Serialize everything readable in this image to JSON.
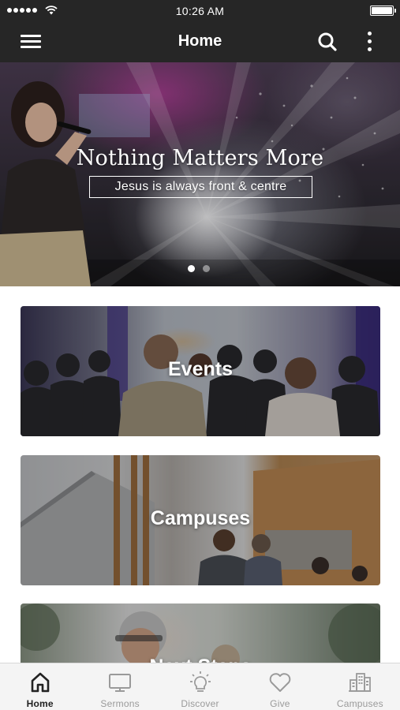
{
  "status_bar": {
    "time": "10:26 AM"
  },
  "nav": {
    "title": "Home"
  },
  "hero": {
    "headline": "Nothing Matters More",
    "tagline": "Jesus is always front & centre",
    "slide_count": 2,
    "active_slide": 1
  },
  "cards": [
    {
      "label": "Events"
    },
    {
      "label": "Campuses"
    },
    {
      "label": "Next Steps"
    }
  ],
  "tabs": [
    {
      "label": "Home",
      "icon": "home-icon",
      "active": true
    },
    {
      "label": "Sermons",
      "icon": "tv-icon",
      "active": false
    },
    {
      "label": "Discover",
      "icon": "lightbulb-icon",
      "active": false
    },
    {
      "label": "Give",
      "icon": "heart-icon",
      "active": false
    },
    {
      "label": "Campuses",
      "icon": "buildings-icon",
      "active": false
    }
  ],
  "colors": {
    "bar": "#262626",
    "tab_inactive": "#9a9a9a",
    "tab_active": "#222222"
  }
}
